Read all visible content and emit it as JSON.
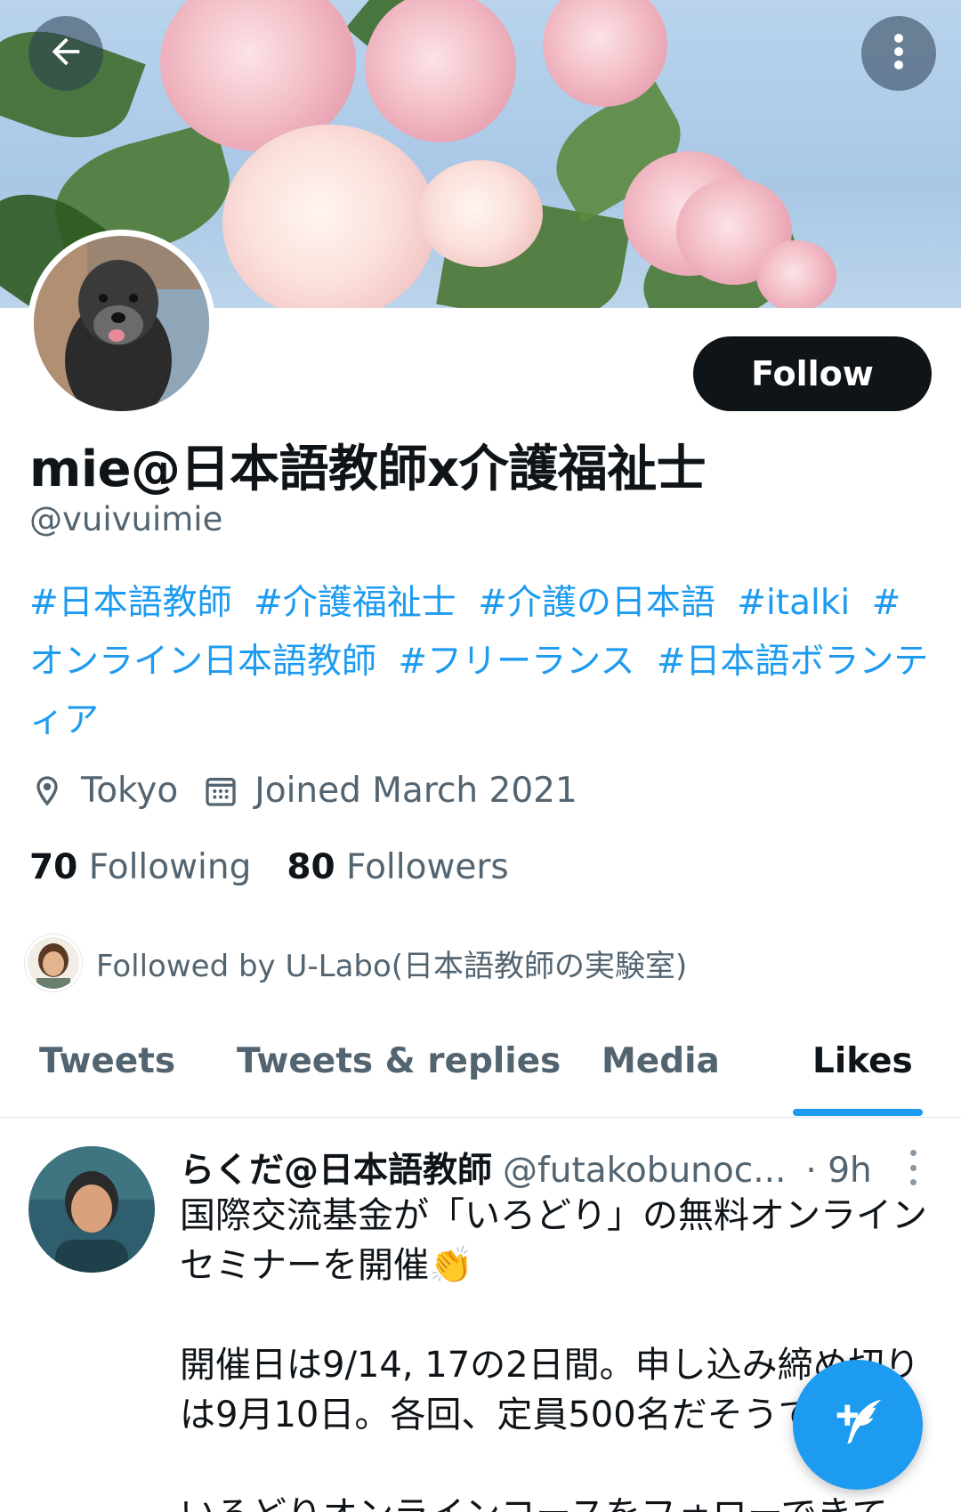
{
  "header": {
    "back_icon": "arrow-left-icon",
    "more_icon": "more-vertical-icon"
  },
  "profile": {
    "display_name": "mie@日本語教師x介護福祉士",
    "handle": "@vuivuimie",
    "follow_label": "Follow",
    "bio_tags": [
      "#日本語教師",
      "#介護福祉士",
      "#介護の日本語",
      "#italki",
      "#オンライン日本語教師",
      "#フリーランス",
      "#日本語ボランティア"
    ],
    "location": "Tokyo",
    "location_icon": "location-pin-icon",
    "joined": "Joined March 2021",
    "joined_icon": "calendar-icon",
    "following_count": "70",
    "following_label": "Following",
    "followers_count": "80",
    "followers_label": "Followers",
    "followed_by": "Followed by U-Labo(日本語教師の実験室)"
  },
  "tabs": [
    {
      "label": "Tweets"
    },
    {
      "label": "Tweets & replies"
    },
    {
      "label": "Media"
    },
    {
      "label": "Likes"
    }
  ],
  "active_tab": "Likes",
  "tweet": {
    "name": "らくだ@日本語教師",
    "handle": "@futakobunoc...",
    "time": "· 9h",
    "lines": [
      "国際交流基金が「いろどり」の無料オンラインセミナーを開催👏",
      "開催日は9/14, 17の2日間。申し込み締め切りは9月10日。各回、定員500名だそうです。",
      "いろどりオンラインコースをフォローできて"
    ]
  },
  "compose_icon": "compose-tweet-icon",
  "colors": {
    "accent": "#1d9bf0",
    "text": "#0f1419",
    "secondary": "#536471"
  }
}
